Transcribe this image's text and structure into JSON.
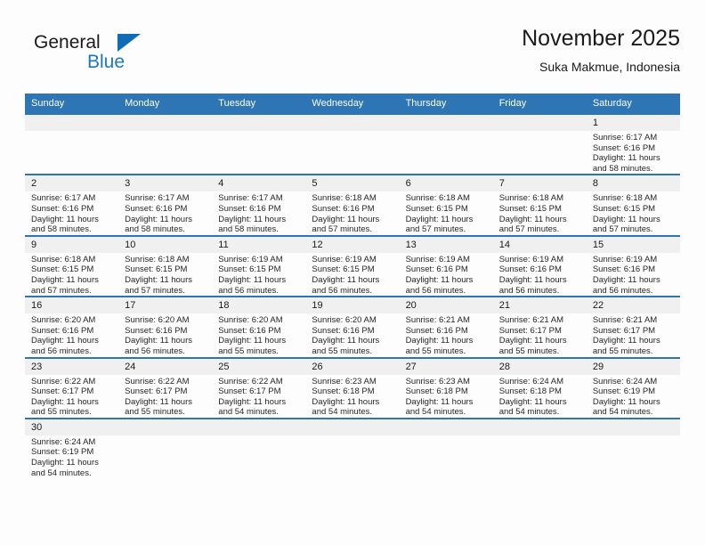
{
  "brand": {
    "name_part1": "General",
    "name_part2": "Blue"
  },
  "header": {
    "title": "November 2025",
    "subtitle": "Suka Makmue, Indonesia"
  },
  "calendar": {
    "weekday_headers": [
      "Sunday",
      "Monday",
      "Tuesday",
      "Wednesday",
      "Thursday",
      "Friday",
      "Saturday"
    ],
    "labels": {
      "sunrise": "Sunrise:",
      "sunset": "Sunset:",
      "daylight": "Daylight:"
    },
    "accent_color": "#2e75b6",
    "daynum_bg": "#f0f0f0",
    "weeks": [
      [
        {
          "day": "",
          "blank": true
        },
        {
          "day": "",
          "blank": true
        },
        {
          "day": "",
          "blank": true
        },
        {
          "day": "",
          "blank": true
        },
        {
          "day": "",
          "blank": true
        },
        {
          "day": "",
          "blank": true
        },
        {
          "day": "1",
          "sunrise": "Sunrise: 6:17 AM",
          "sunset": "Sunset: 6:16 PM",
          "daylight": "Daylight: 11 hours and 58 minutes."
        }
      ],
      [
        {
          "day": "2",
          "sunrise": "Sunrise: 6:17 AM",
          "sunset": "Sunset: 6:16 PM",
          "daylight": "Daylight: 11 hours and 58 minutes."
        },
        {
          "day": "3",
          "sunrise": "Sunrise: 6:17 AM",
          "sunset": "Sunset: 6:16 PM",
          "daylight": "Daylight: 11 hours and 58 minutes."
        },
        {
          "day": "4",
          "sunrise": "Sunrise: 6:17 AM",
          "sunset": "Sunset: 6:16 PM",
          "daylight": "Daylight: 11 hours and 58 minutes."
        },
        {
          "day": "5",
          "sunrise": "Sunrise: 6:18 AM",
          "sunset": "Sunset: 6:16 PM",
          "daylight": "Daylight: 11 hours and 57 minutes."
        },
        {
          "day": "6",
          "sunrise": "Sunrise: 6:18 AM",
          "sunset": "Sunset: 6:15 PM",
          "daylight": "Daylight: 11 hours and 57 minutes."
        },
        {
          "day": "7",
          "sunrise": "Sunrise: 6:18 AM",
          "sunset": "Sunset: 6:15 PM",
          "daylight": "Daylight: 11 hours and 57 minutes."
        },
        {
          "day": "8",
          "sunrise": "Sunrise: 6:18 AM",
          "sunset": "Sunset: 6:15 PM",
          "daylight": "Daylight: 11 hours and 57 minutes."
        }
      ],
      [
        {
          "day": "9",
          "sunrise": "Sunrise: 6:18 AM",
          "sunset": "Sunset: 6:15 PM",
          "daylight": "Daylight: 11 hours and 57 minutes."
        },
        {
          "day": "10",
          "sunrise": "Sunrise: 6:18 AM",
          "sunset": "Sunset: 6:15 PM",
          "daylight": "Daylight: 11 hours and 57 minutes."
        },
        {
          "day": "11",
          "sunrise": "Sunrise: 6:19 AM",
          "sunset": "Sunset: 6:15 PM",
          "daylight": "Daylight: 11 hours and 56 minutes."
        },
        {
          "day": "12",
          "sunrise": "Sunrise: 6:19 AM",
          "sunset": "Sunset: 6:15 PM",
          "daylight": "Daylight: 11 hours and 56 minutes."
        },
        {
          "day": "13",
          "sunrise": "Sunrise: 6:19 AM",
          "sunset": "Sunset: 6:16 PM",
          "daylight": "Daylight: 11 hours and 56 minutes."
        },
        {
          "day": "14",
          "sunrise": "Sunrise: 6:19 AM",
          "sunset": "Sunset: 6:16 PM",
          "daylight": "Daylight: 11 hours and 56 minutes."
        },
        {
          "day": "15",
          "sunrise": "Sunrise: 6:19 AM",
          "sunset": "Sunset: 6:16 PM",
          "daylight": "Daylight: 11 hours and 56 minutes."
        }
      ],
      [
        {
          "day": "16",
          "sunrise": "Sunrise: 6:20 AM",
          "sunset": "Sunset: 6:16 PM",
          "daylight": "Daylight: 11 hours and 56 minutes."
        },
        {
          "day": "17",
          "sunrise": "Sunrise: 6:20 AM",
          "sunset": "Sunset: 6:16 PM",
          "daylight": "Daylight: 11 hours and 56 minutes."
        },
        {
          "day": "18",
          "sunrise": "Sunrise: 6:20 AM",
          "sunset": "Sunset: 6:16 PM",
          "daylight": "Daylight: 11 hours and 55 minutes."
        },
        {
          "day": "19",
          "sunrise": "Sunrise: 6:20 AM",
          "sunset": "Sunset: 6:16 PM",
          "daylight": "Daylight: 11 hours and 55 minutes."
        },
        {
          "day": "20",
          "sunrise": "Sunrise: 6:21 AM",
          "sunset": "Sunset: 6:16 PM",
          "daylight": "Daylight: 11 hours and 55 minutes."
        },
        {
          "day": "21",
          "sunrise": "Sunrise: 6:21 AM",
          "sunset": "Sunset: 6:17 PM",
          "daylight": "Daylight: 11 hours and 55 minutes."
        },
        {
          "day": "22",
          "sunrise": "Sunrise: 6:21 AM",
          "sunset": "Sunset: 6:17 PM",
          "daylight": "Daylight: 11 hours and 55 minutes."
        }
      ],
      [
        {
          "day": "23",
          "sunrise": "Sunrise: 6:22 AM",
          "sunset": "Sunset: 6:17 PM",
          "daylight": "Daylight: 11 hours and 55 minutes."
        },
        {
          "day": "24",
          "sunrise": "Sunrise: 6:22 AM",
          "sunset": "Sunset: 6:17 PM",
          "daylight": "Daylight: 11 hours and 55 minutes."
        },
        {
          "day": "25",
          "sunrise": "Sunrise: 6:22 AM",
          "sunset": "Sunset: 6:17 PM",
          "daylight": "Daylight: 11 hours and 54 minutes."
        },
        {
          "day": "26",
          "sunrise": "Sunrise: 6:23 AM",
          "sunset": "Sunset: 6:18 PM",
          "daylight": "Daylight: 11 hours and 54 minutes."
        },
        {
          "day": "27",
          "sunrise": "Sunrise: 6:23 AM",
          "sunset": "Sunset: 6:18 PM",
          "daylight": "Daylight: 11 hours and 54 minutes."
        },
        {
          "day": "28",
          "sunrise": "Sunrise: 6:24 AM",
          "sunset": "Sunset: 6:18 PM",
          "daylight": "Daylight: 11 hours and 54 minutes."
        },
        {
          "day": "29",
          "sunrise": "Sunrise: 6:24 AM",
          "sunset": "Sunset: 6:19 PM",
          "daylight": "Daylight: 11 hours and 54 minutes."
        }
      ],
      [
        {
          "day": "30",
          "sunrise": "Sunrise: 6:24 AM",
          "sunset": "Sunset: 6:19 PM",
          "daylight": "Daylight: 11 hours and 54 minutes."
        },
        {
          "day": "",
          "blank": true
        },
        {
          "day": "",
          "blank": true
        },
        {
          "day": "",
          "blank": true
        },
        {
          "day": "",
          "blank": true
        },
        {
          "day": "",
          "blank": true
        },
        {
          "day": "",
          "blank": true
        }
      ]
    ]
  }
}
